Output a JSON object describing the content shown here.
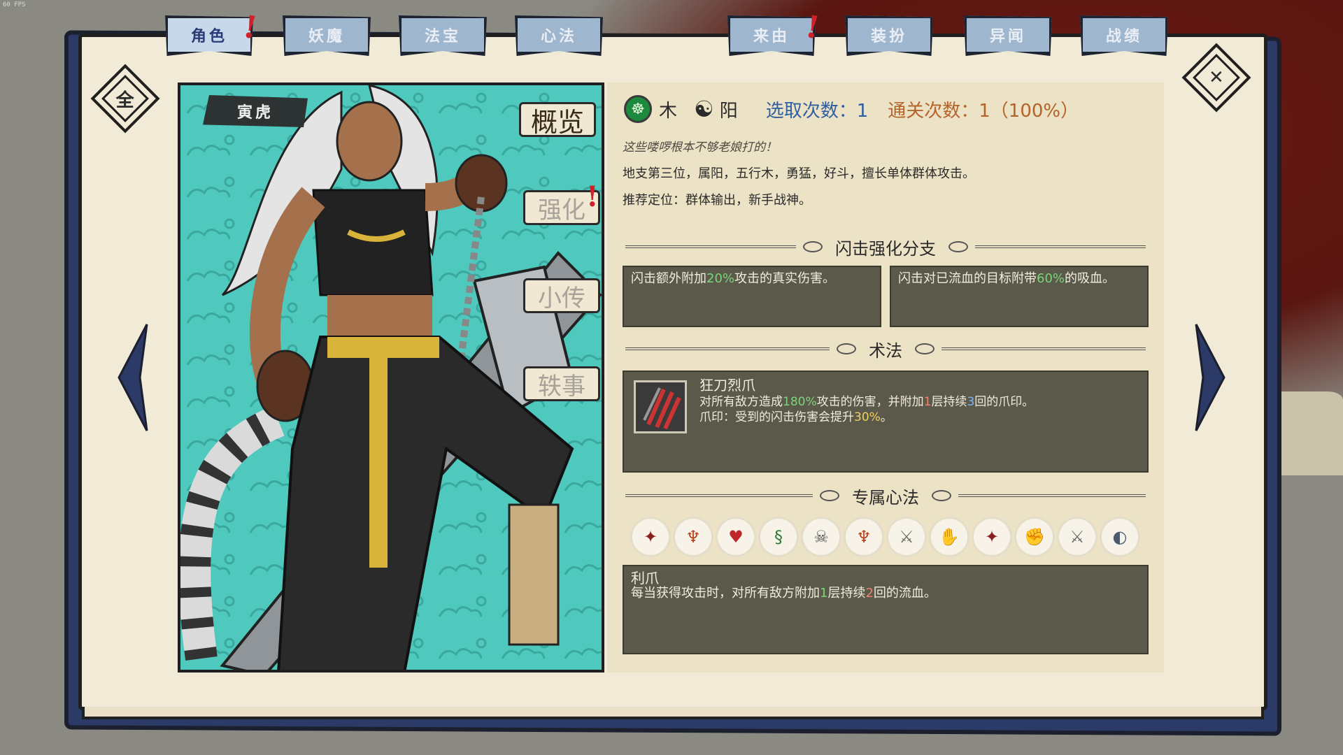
{
  "debug": {
    "fps": "60 FPS"
  },
  "tabs": [
    {
      "label": "角色",
      "active": true,
      "alert": true
    },
    {
      "label": "妖魔",
      "active": false,
      "alert": false
    },
    {
      "label": "法宝",
      "active": false,
      "alert": false
    },
    {
      "label": "心法",
      "active": false,
      "alert": false
    },
    {
      "label": "来由",
      "active": false,
      "alert": true
    },
    {
      "label": "装扮",
      "active": false,
      "alert": false
    },
    {
      "label": "异闻",
      "active": false,
      "alert": false
    },
    {
      "label": "战绩",
      "active": false,
      "alert": false
    }
  ],
  "alert_mark": "!",
  "corner_left": "全",
  "corner_right": "✕",
  "character": {
    "name": "寅虎",
    "side_tabs": [
      "概览",
      "强化",
      "小传",
      "轶事"
    ],
    "element": "木",
    "element_icon": "☸",
    "polarity_icon": "☯",
    "polarity": "阳",
    "pick_count_label": "选取次数：1",
    "clear_count_label": "通关次数：1（100%）",
    "quote": "这些喽啰根本不够老娘打的！",
    "desc1": "地支第三位，属阳，五行木，勇猛，好斗，擅长单体群体攻击。",
    "desc2": "推荐定位：群体输出，新手战神。"
  },
  "branch": {
    "title": "闪击强化分支",
    "left": {
      "pre": "闪击额外附加",
      "hl": "20%",
      "post": "攻击的真实伤害。"
    },
    "right": {
      "pre": "闪击对已流血的目标附带",
      "hl": "60%",
      "post": "的吸血。"
    }
  },
  "skill": {
    "section": "术法",
    "name": "狂刀烈爪",
    "line1": {
      "a": "对所有敌方造成",
      "b": "180%",
      "c": "攻击的伤害，并附加",
      "d": "1",
      "e": "层持续",
      "f": "3",
      "g": "回的爪印。"
    },
    "line2": {
      "a": "爪印：受到的闪击伤害会提升",
      "b": "30%",
      "c": "。"
    }
  },
  "mind": {
    "section": "专属心法",
    "icons": [
      "claw-icon",
      "dragon-icon",
      "broken-heart-icon",
      "snake-icon",
      "skull-icon",
      "dragon-icon",
      "bloody-blade-icon",
      "arm-icon",
      "claw-icon",
      "fist-icon",
      "bloody-blade-icon",
      "shield-icon"
    ],
    "glyphs": [
      "✦",
      "♆",
      "♥",
      "§",
      "☠",
      "♆",
      "⚔",
      "✋",
      "✦",
      "✊",
      "⚔",
      "◐"
    ],
    "selected_name": "利爪",
    "selected_desc": {
      "a": "每当获得攻击时，对所有敌方附加",
      "b": "1",
      "c": "层持续",
      "d": "2",
      "e": "回的流血。"
    }
  },
  "colors": {
    "accent_blue": "#2f5fa0",
    "accent_orange": "#b5632a",
    "highlight_green": "#7bd47b",
    "alert_red": "#d0202a"
  }
}
